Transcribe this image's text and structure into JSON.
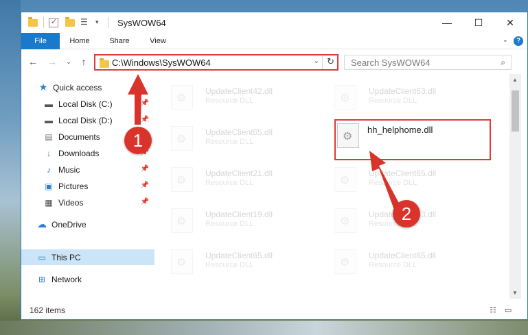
{
  "window": {
    "title": "SysWOW64",
    "minimize_glyph": "—",
    "maximize_glyph": "☐",
    "close_glyph": "✕"
  },
  "ribbon": {
    "tabs": [
      {
        "label": "File"
      },
      {
        "label": "Home"
      },
      {
        "label": "Share"
      },
      {
        "label": "View"
      }
    ],
    "help": "?"
  },
  "address": {
    "path": "C:\\Windows\\SysWOW64",
    "search_placeholder": "Search SysWOW64"
  },
  "nav": {
    "items": [
      {
        "label": "Quick access",
        "icon": "star-icon",
        "pinned": false
      },
      {
        "label": "Local Disk (C:)",
        "icon": "drive-icon",
        "pinned": true
      },
      {
        "label": "Local Disk (D:)",
        "icon": "drive-icon",
        "pinned": true
      },
      {
        "label": "Documents",
        "icon": "documents-icon",
        "pinned": true
      },
      {
        "label": "Downloads",
        "icon": "download-icon",
        "pinned": true
      },
      {
        "label": "Music",
        "icon": "music-icon",
        "pinned": true
      },
      {
        "label": "Pictures",
        "icon": "pictures-icon",
        "pinned": true
      },
      {
        "label": "Videos",
        "icon": "videos-icon",
        "pinned": true
      },
      {
        "label": "OneDrive",
        "icon": "onedrive-icon",
        "pinned": false
      },
      {
        "label": "This PC",
        "icon": "pc-icon",
        "pinned": false,
        "selected": true
      },
      {
        "label": "Network",
        "icon": "network-icon",
        "pinned": false
      }
    ]
  },
  "files": [
    {
      "name": "UpdateClient42.dll",
      "type": "Resource DLL"
    },
    {
      "name": "UpdateClient63.dll",
      "type": "Resource DLL"
    },
    {
      "name": "UpdateClient65.dll",
      "type": "Resource DLL"
    },
    {
      "name": "hh_helphome.dll",
      "type": ""
    },
    {
      "name": "UpdateClient21.dll",
      "type": "Resource DLL"
    },
    {
      "name": "UpdateClient65.dll",
      "type": "Resource DLL"
    },
    {
      "name": "UpdateClient19.dll",
      "type": "Resource DLL"
    },
    {
      "name": "UpdateClient63.dll",
      "type": "Resource DLL"
    },
    {
      "name": "UpdateClient65.dll",
      "type": "Resource DLL"
    },
    {
      "name": "UpdateClient65.dll",
      "type": "Resource DLL"
    }
  ],
  "status": {
    "count": "162 items"
  },
  "annotations": {
    "step1": "1",
    "step2": "2",
    "color": "#d9342b"
  }
}
